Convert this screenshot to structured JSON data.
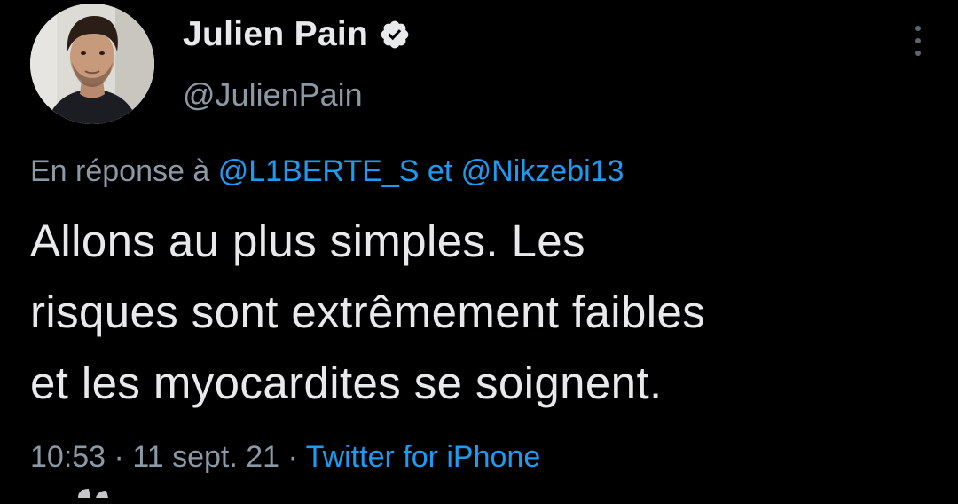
{
  "author": {
    "display_name": "Julien Pain",
    "handle": "@JulienPain",
    "verified": true
  },
  "reply": {
    "prefix": "En réponse à",
    "mention1": "@L1BERTE_S",
    "connector": "et",
    "mention2": "@Nikzebi13"
  },
  "tweet": {
    "line1": "Allons au plus simples. Les",
    "line2": "risques sont extrêmement faibles",
    "line3": "et les myocardites se soignent."
  },
  "meta": {
    "time": "10:53",
    "separator": "·",
    "date": "11 sept. 21",
    "source": "Twitter for iPhone"
  },
  "icons": {
    "avatar": "profile-photo",
    "verified": "verified-badge-icon",
    "more": "more-vertical-icon"
  },
  "colors": {
    "background": "#000000",
    "text": "#e7e9ea",
    "secondary": "#8b98a5",
    "link": "#1d9bf0"
  }
}
